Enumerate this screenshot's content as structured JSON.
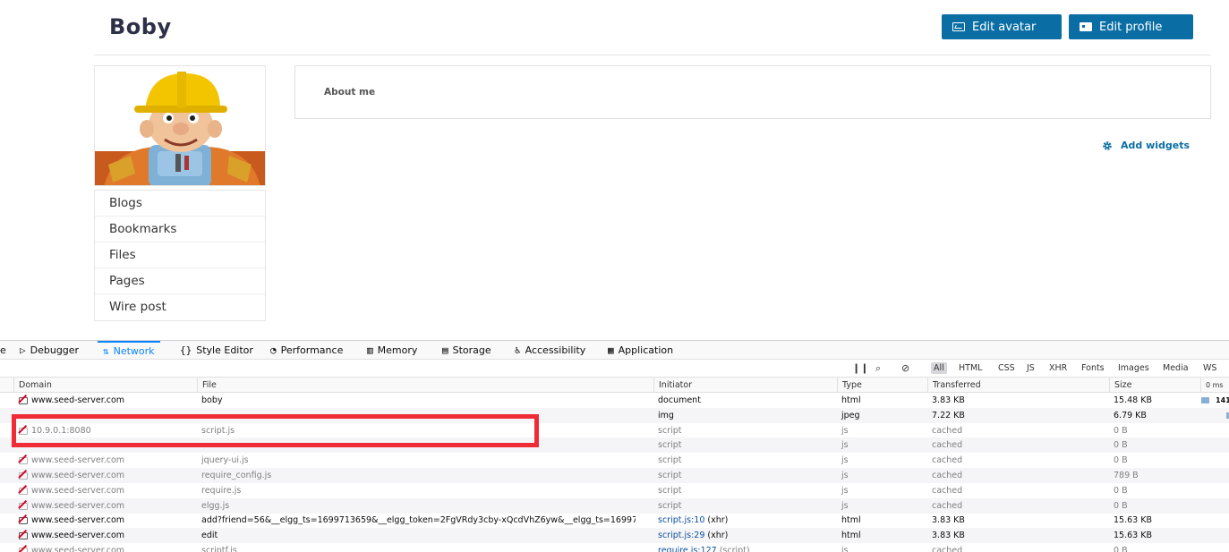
{
  "profile": {
    "name": "Boby",
    "edit_avatar": "Edit avatar",
    "edit_profile": "Edit profile",
    "about_label": "About me",
    "add_widgets": "Add widgets",
    "menu": [
      "Blogs",
      "Bookmarks",
      "Files",
      "Pages",
      "Wire post"
    ]
  },
  "devtools": {
    "tabs": [
      {
        "label": "e",
        "icon": "inspector-icon"
      },
      {
        "label": "Debugger",
        "icon": "debugger-icon"
      },
      {
        "label": "Network",
        "icon": "network-icon",
        "active": true
      },
      {
        "label": "Style Editor",
        "icon": "braces-icon"
      },
      {
        "label": "Performance",
        "icon": "gauge-icon"
      },
      {
        "label": "Memory",
        "icon": "memory-icon"
      },
      {
        "label": "Storage",
        "icon": "storage-icon"
      },
      {
        "label": "Accessibility",
        "icon": "accessibility-icon"
      },
      {
        "label": "Application",
        "icon": "grid-icon"
      }
    ],
    "filters": [
      "All",
      "HTML",
      "CSS",
      "JS",
      "XHR",
      "Fonts",
      "Images",
      "Media",
      "WS"
    ],
    "active_filter": "All",
    "columns": [
      "Domain",
      "File",
      "Initiator",
      "Type",
      "Transferred",
      "Size",
      "0 ms"
    ],
    "rows": [
      {
        "domain": "www.seed-server.com",
        "file": "boby",
        "initiator": "document",
        "type": "html",
        "transferred": "3.83 KB",
        "size": "15.48 KB",
        "timing": "141",
        "state": "live"
      },
      {
        "domain": "",
        "file": "",
        "initiator": "img",
        "type": "jpeg",
        "transferred": "7.22 KB",
        "size": "6.79 KB",
        "timing": "",
        "state": "live"
      },
      {
        "domain": "10.9.0.1:8080",
        "file": "script.js",
        "initiator": "script",
        "type": "js",
        "transferred": "cached",
        "size": "0 B",
        "timing": "",
        "state": "cached"
      },
      {
        "domain": "",
        "file": "",
        "initiator": "script",
        "type": "js",
        "transferred": "cached",
        "size": "0 B",
        "timing": "",
        "state": "cached"
      },
      {
        "domain": "www.seed-server.com",
        "file": "jquery-ui.js",
        "initiator": "script",
        "type": "js",
        "transferred": "cached",
        "size": "0 B",
        "timing": "",
        "state": "cached"
      },
      {
        "domain": "www.seed-server.com",
        "file": "require_config.js",
        "initiator": "script",
        "type": "js",
        "transferred": "cached",
        "size": "789 B",
        "timing": "",
        "state": "cached"
      },
      {
        "domain": "www.seed-server.com",
        "file": "require.js",
        "initiator": "script",
        "type": "js",
        "transferred": "cached",
        "size": "0 B",
        "timing": "",
        "state": "cached"
      },
      {
        "domain": "www.seed-server.com",
        "file": "elgg.js",
        "initiator": "script",
        "type": "js",
        "transferred": "cached",
        "size": "0 B",
        "timing": "",
        "state": "cached"
      },
      {
        "domain": "www.seed-server.com",
        "file": "add?friend=56&__elgg_ts=1699713659&__elgg_token=2FgVRdy3cby-xQcdVhZ6yw&__elgg_ts=16997",
        "initiator": "script.js:10",
        "initiator_suffix": "(xhr)",
        "type": "html",
        "transferred": "3.83 KB",
        "size": "15.63 KB",
        "timing": "",
        "state": "live"
      },
      {
        "domain": "www.seed-server.com",
        "file": "edit",
        "initiator": "script.js:29",
        "initiator_suffix": "(xhr)",
        "type": "html",
        "transferred": "3.83 KB",
        "size": "15.63 KB",
        "timing": "",
        "state": "live"
      },
      {
        "domain": "www.seed-server.com",
        "file": "scriptf.js",
        "initiator": "require.js:127",
        "initiator_suffix": "(script)",
        "type": "js",
        "transferred": "cached",
        "size": "0 B",
        "timing": "",
        "state": "cached"
      }
    ]
  }
}
